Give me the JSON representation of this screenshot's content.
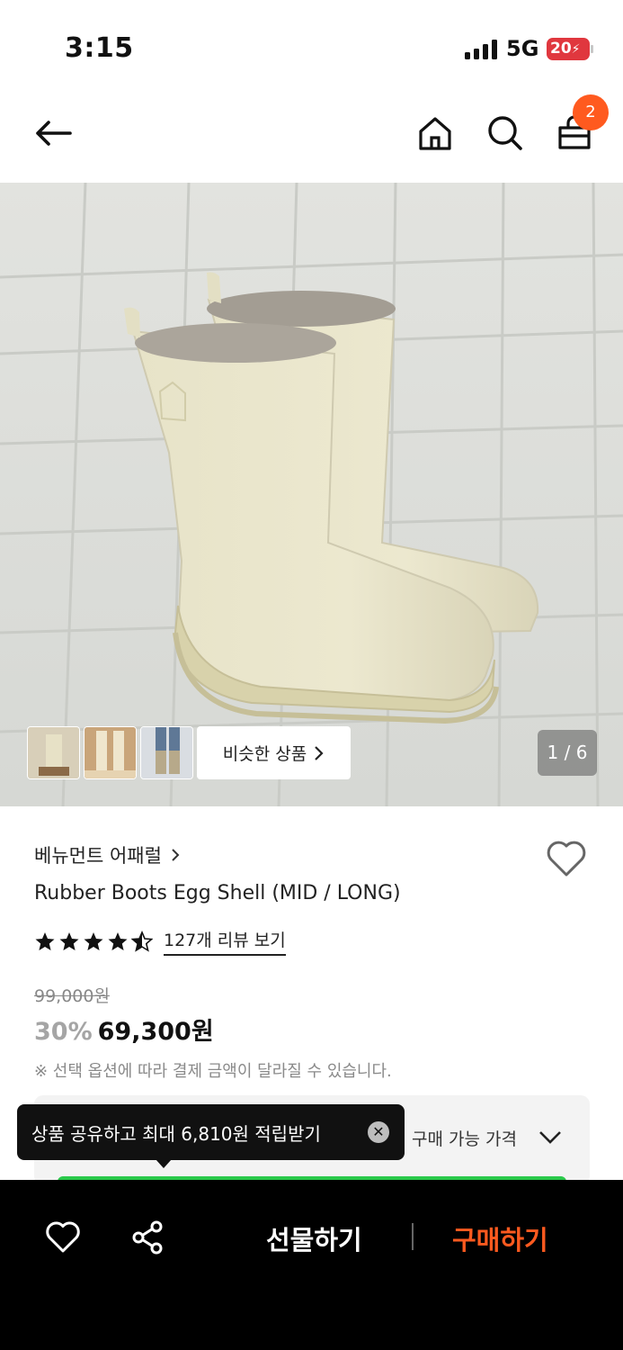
{
  "status": {
    "time": "3:15",
    "network": "5G",
    "battery": "20"
  },
  "nav": {
    "cart_count": "2"
  },
  "gallery": {
    "similar_label": "비슷한 상품",
    "pager": "1 / 6"
  },
  "product": {
    "brand": "베뉴먼트 어패럴",
    "name": "Rubber Boots Egg Shell (MID / LONG)",
    "rating_stars": 4.5,
    "review_link": "127개 리뷰 보기",
    "original_price": "99,000원",
    "discount": "30%",
    "sale_price": "69,300원",
    "notice": "※ 선택 옵션에 따라 결제 금액이 달라질 수 있습니다."
  },
  "price_panel": {
    "label": "구매 가능 가격"
  },
  "tooltip": {
    "text": "상품 공유하고 최대 6,810원 적립받기"
  },
  "bottom": {
    "gift_label": "선물하기",
    "buy_label": "구매하기"
  },
  "colors": {
    "accent": "#ff5a1f",
    "green": "#2ac94a"
  }
}
